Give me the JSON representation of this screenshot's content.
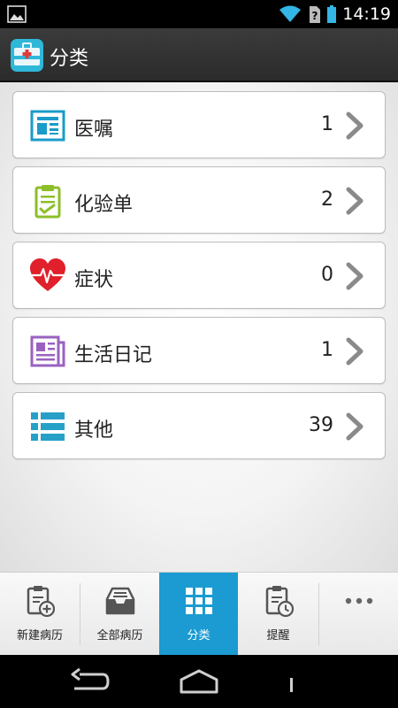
{
  "status_bar": {
    "time": "14:19",
    "icons": [
      "gallery-icon",
      "wifi-icon",
      "sim-alert-icon",
      "battery-icon"
    ]
  },
  "action_bar": {
    "title": "分类",
    "app_icon": "medical-kit-icon"
  },
  "categories": [
    {
      "label": "医嘱",
      "count": "1",
      "icon": "document-icon",
      "color": "#1a9bc9"
    },
    {
      "label": "化验单",
      "count": "2",
      "icon": "clipboard-icon",
      "color": "#8cbf2a"
    },
    {
      "label": "症状",
      "count": "0",
      "icon": "heartbeat-icon",
      "color": "#e0202a"
    },
    {
      "label": "生活日记",
      "count": "1",
      "icon": "newspaper-icon",
      "color": "#9a62c0"
    },
    {
      "label": "其他",
      "count": "39",
      "icon": "list-icon",
      "color": "#27a0c8"
    }
  ],
  "tabs": [
    {
      "label": "新建病历",
      "icon": "new-record-icon"
    },
    {
      "label": "全部病历",
      "icon": "inbox-icon"
    },
    {
      "label": "分类",
      "icon": "grid-icon",
      "active": true
    },
    {
      "label": "提醒",
      "icon": "reminder-icon"
    },
    {
      "label": "",
      "icon": "more-icon"
    }
  ],
  "colors": {
    "accent": "#1b9bd1",
    "action_bar": "#333333"
  }
}
